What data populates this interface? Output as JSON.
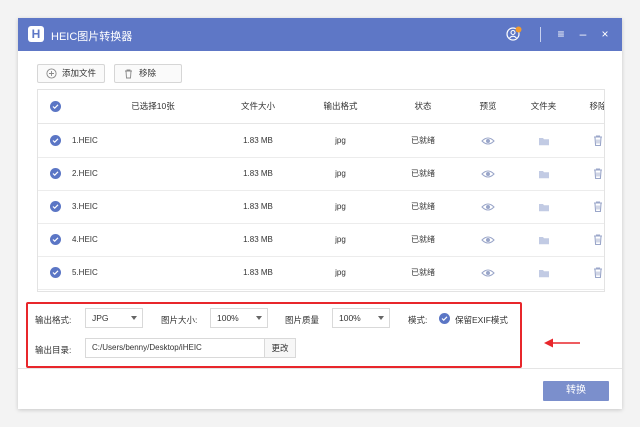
{
  "app": {
    "title": "HEIC图片转换器",
    "logo_letter": "H",
    "accent": "#5e77c6"
  },
  "window_controls": {
    "menu": "≡",
    "minimize": "–",
    "close": "×"
  },
  "toolbar": {
    "add_label": "添加文件",
    "remove_label": "移除"
  },
  "table": {
    "headers": {
      "selected": "已选择10张",
      "size": "文件大小",
      "format": "输出格式",
      "status": "状态",
      "preview": "预览",
      "folder": "文件夹",
      "remove": "移除"
    },
    "rows": [
      {
        "name": "1.HEIC",
        "size": "1.83 MB",
        "format": "jpg",
        "status": "已就绪"
      },
      {
        "name": "2.HEIC",
        "size": "1.83 MB",
        "format": "jpg",
        "status": "已就绪"
      },
      {
        "name": "3.HEIC",
        "size": "1.83 MB",
        "format": "jpg",
        "status": "已就绪"
      },
      {
        "name": "4.HEIC",
        "size": "1.83 MB",
        "format": "jpg",
        "status": "已就绪"
      },
      {
        "name": "5.HEIC",
        "size": "1.83 MB",
        "format": "jpg",
        "status": "已就绪"
      }
    ]
  },
  "settings": {
    "format_label": "输出格式:",
    "format_value": "JPG",
    "size_label": "图片大小:",
    "size_value": "100%",
    "quality_label": "图片质量",
    "quality_value": "100%",
    "mode_label": "模式:",
    "exif_label": "保留EXIF模式",
    "outdir_label": "输出目录:",
    "outdir_value": "C:/Users/benny/Desktop/iHEIC",
    "change_label": "更改"
  },
  "convert_label": "转换",
  "colors": {
    "highlight": "#e8262b",
    "check": "#5b76c5",
    "convert": "#7b8fcc",
    "icon_gray": "#9aa6c9"
  }
}
